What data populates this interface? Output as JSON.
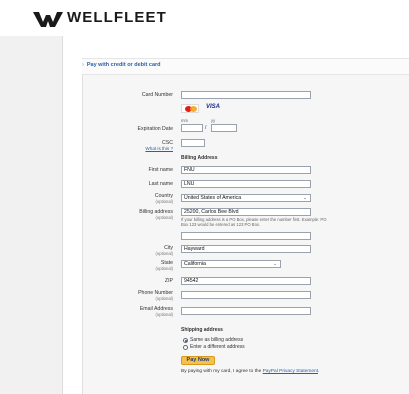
{
  "brand": {
    "name": "WELLFLEET",
    "logo_icon": "wellfleet-logo-icon"
  },
  "section": {
    "title": "Pay with credit or debit card",
    "arrow": "›"
  },
  "card": {
    "number_label": "Card Number",
    "number_value": "",
    "brands": [
      "MasterCard",
      "VISA"
    ],
    "visa_text": "VISA",
    "expiration_label": "Expiration Date",
    "mm_hint": "mm",
    "yy_hint": "yy",
    "exp_separator": "/",
    "csc_label": "CSC",
    "csc_help": "What is this ?"
  },
  "billing": {
    "heading": "Billing Address",
    "first_name_label": "First name",
    "first_name": "FNU",
    "last_name_label": "Last name",
    "last_name": "LNU",
    "country_label": "Country",
    "country_optional": "(optional)",
    "country": "United States of America",
    "address_label": "Billing address",
    "address_optional": "(optional)",
    "address_line1": "25200, Carlos Bee Blvd",
    "address_hint": "If your billing address is a PO Box, please enter the number first. Example: PO Box 123 would be entered as 123 PO Box.",
    "address_line2": "",
    "city_label": "City",
    "city_optional": "(optional)",
    "city": "Hayward",
    "state_label": "State",
    "state_optional": "(optional)",
    "state": "California",
    "zip_label": "ZIP",
    "zip": "94542",
    "phone_label": "Phone Number",
    "phone_optional": "(optional)",
    "phone": "",
    "email_label": "Email Address",
    "email_optional": "(optional)",
    "email": ""
  },
  "shipping": {
    "heading": "Shipping address",
    "option_same": "Same as billing address",
    "option_different": "Enter a different address",
    "selected": "same"
  },
  "actions": {
    "pay_now": "Pay Now"
  },
  "footer": {
    "agree_prefix": "By paying with my card, I agree to the ",
    "agree_link": "PayPal Privacy Statement",
    "agree_suffix": "."
  },
  "colors": {
    "link": "#2b5fa6",
    "pay_button": "#f6c04e",
    "accent_visa": "#1a2b8c"
  }
}
